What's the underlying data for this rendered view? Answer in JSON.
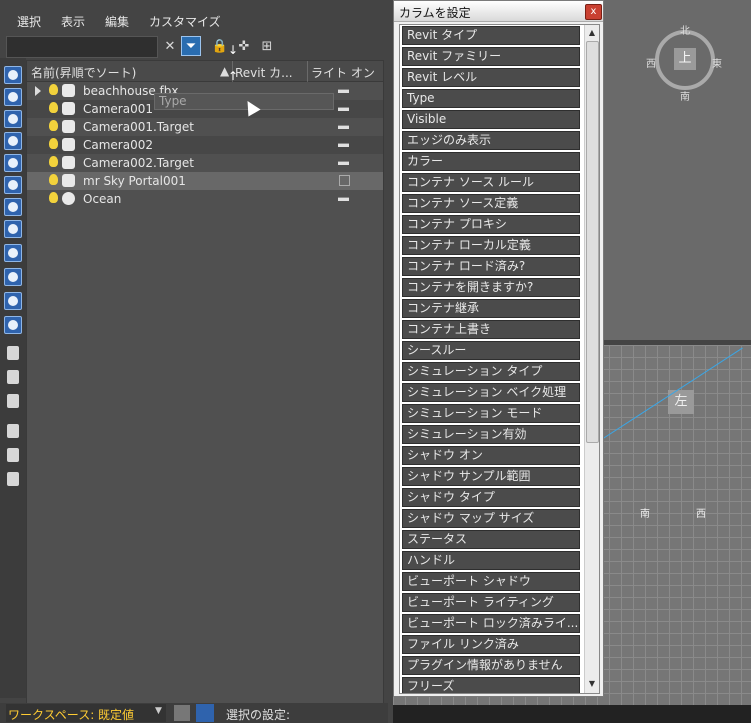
{
  "menu": [
    "選択",
    "表示",
    "編集",
    "カスタマイズ"
  ],
  "tree": {
    "columns": [
      "名前(昇順でソート)",
      "Revit カ...",
      "ライト オン"
    ],
    "rows": [
      {
        "name": "beachhouse.fbx",
        "icon": "group-icon",
        "toggle": "dash"
      },
      {
        "name": "Camera001",
        "icon": "camera-icon",
        "toggle": "dash"
      },
      {
        "name": "Camera001.Target",
        "icon": "camera-target-icon",
        "toggle": "dash"
      },
      {
        "name": "Camera002",
        "icon": "camera-icon",
        "toggle": "dash"
      },
      {
        "name": "Camera002.Target",
        "icon": "camera-target-icon",
        "toggle": "dash"
      },
      {
        "name": "mr Sky Portal001",
        "icon": "sky-portal-icon",
        "toggle": "checkbox"
      },
      {
        "name": "Ocean",
        "icon": "sphere-icon",
        "toggle": "dash"
      }
    ],
    "drag_ghost": "Type"
  },
  "status": {
    "workspace_label": "ワークスペース: 既定値",
    "selection_label": "選択の設定:"
  },
  "viewport": {
    "top_face": "上",
    "left_face": "左",
    "compass": {
      "north": "北",
      "south": "南",
      "east": "東",
      "west": "西"
    },
    "left_labels": [
      "南",
      "西"
    ]
  },
  "dialog": {
    "title": "カラムを設定",
    "close": "x",
    "columns": [
      "Revit タイプ",
      "Revit ファミリー",
      "Revit レベル",
      "Type",
      "Visible",
      "エッジのみ表示",
      "カラー",
      "コンテナ ソース ルール",
      "コンテナ ソース定義",
      "コンテナ プロキシ",
      "コンテナ ローカル定義",
      "コンテナ ロード済み?",
      "コンテナを開きますか?",
      "コンテナ継承",
      "コンテナ上書き",
      "シースルー",
      "シミュレーション タイプ",
      "シミュレーション ベイク処理",
      "シミュレーション モード",
      "シミュレーション有効",
      "シャドウ オン",
      "シャドウ サンプル範囲",
      "シャドウ タイプ",
      "シャドウ マップ サイズ",
      "ステータス",
      "ハンドル",
      "ビューポート シャドウ",
      "ビューポート ライティング",
      "ビューポート ロック済みライ...",
      "ファイル リンク済み",
      "プラグイン情報がありません",
      "フリーズ"
    ]
  }
}
